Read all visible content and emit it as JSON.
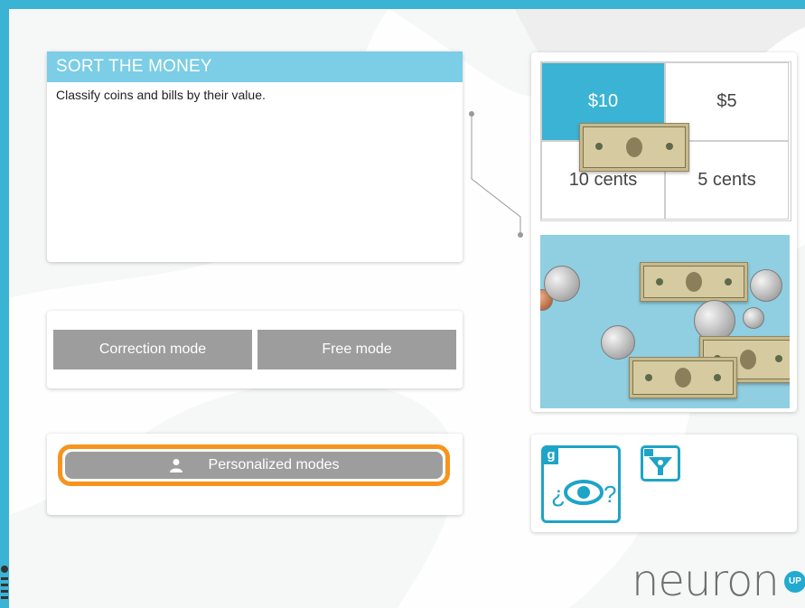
{
  "activity": {
    "title": "SORT THE MONEY",
    "description": "Classify coins and bills by their value."
  },
  "modes": {
    "correction_label": "Correction mode",
    "free_label": "Free mode",
    "personalized_label": "Personalized modes"
  },
  "preview": {
    "categories": [
      "$10",
      "$5",
      "10 cents",
      "5 cents"
    ],
    "selected_category": "$10"
  },
  "tools": {
    "g_letter": "g",
    "g_mark": "¿ ?"
  },
  "brand": {
    "logo_text": "neuron",
    "logo_badge": "UP",
    "accent": "#3bb3d4",
    "highlight": "#f7941d",
    "button_gray": "#9d9d9d"
  },
  "icons": [
    "user-icon",
    "eye-question-icon",
    "funnel-icon",
    "menu-icon"
  ]
}
